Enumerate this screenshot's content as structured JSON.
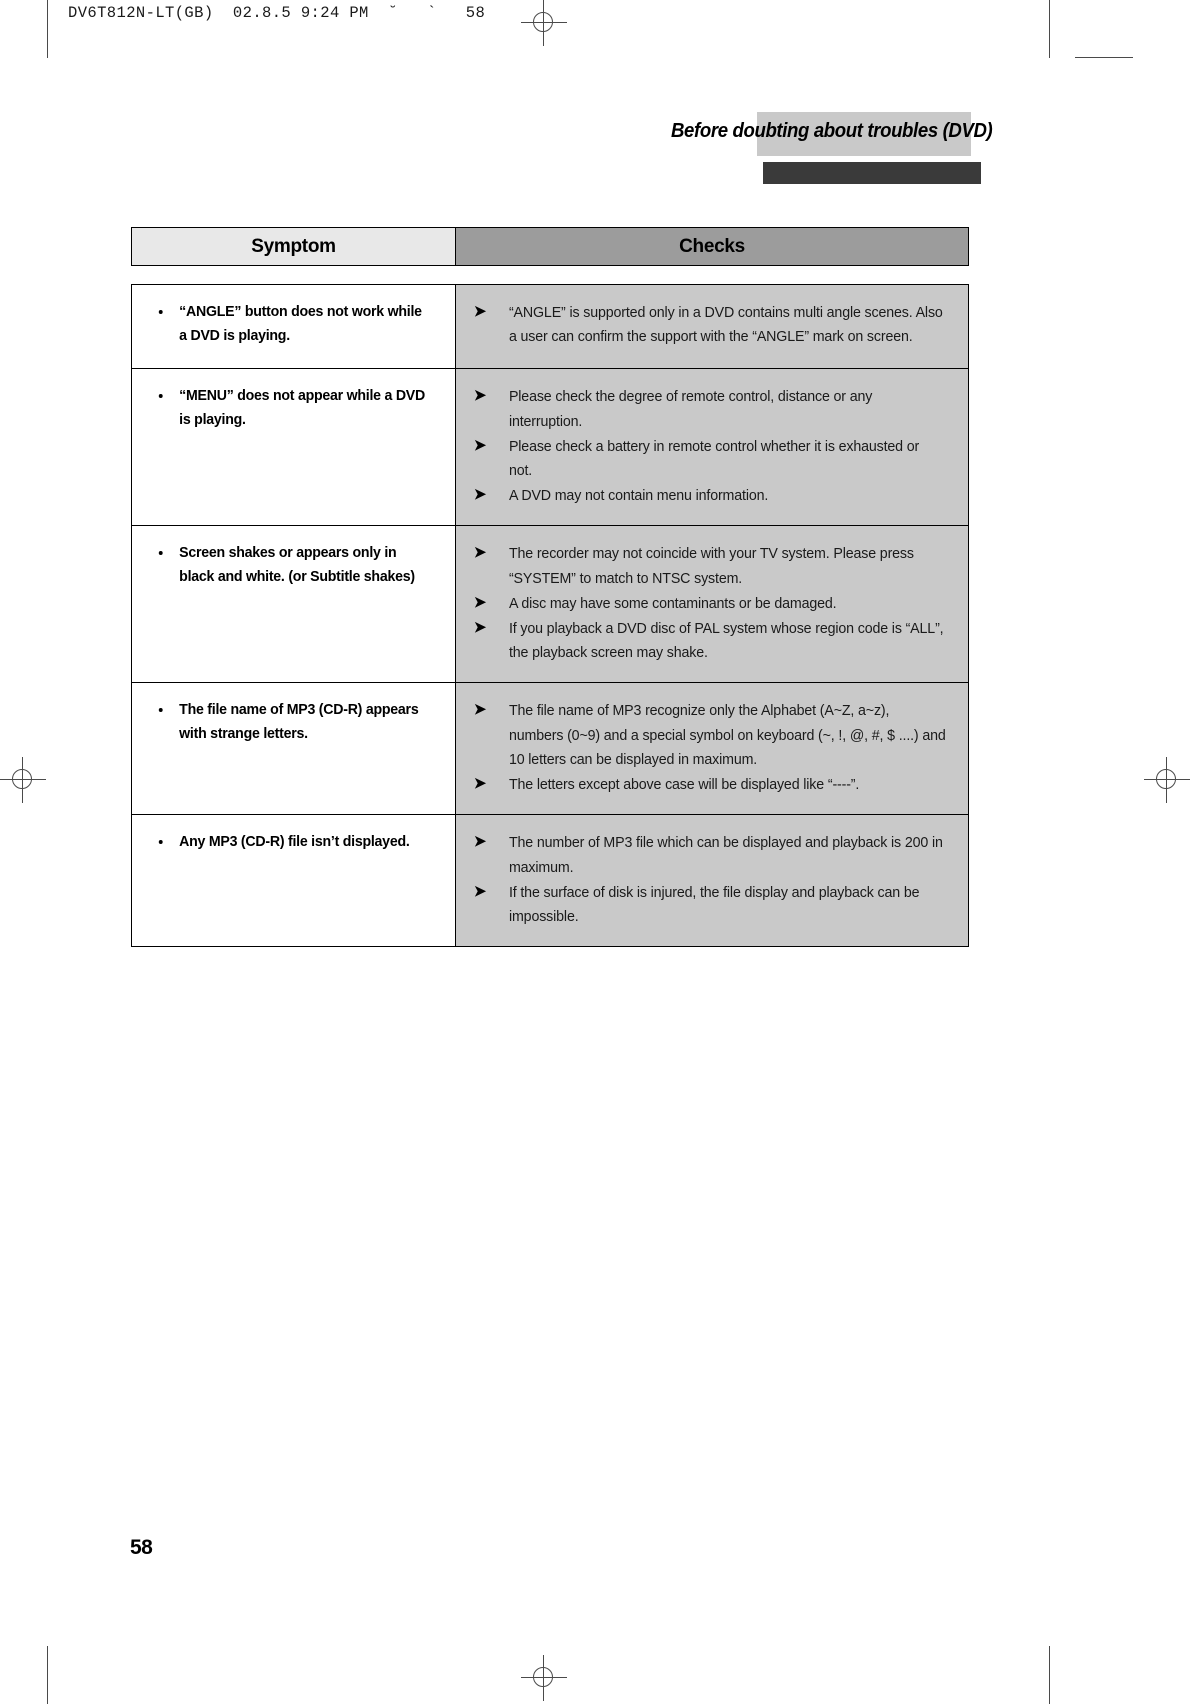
{
  "print_slug": "DV6T812N-LT(GB)  02.8.5 9:24 PM  ˘   `   58",
  "title": "Before doubting about troubles (DVD)",
  "page_number": "58",
  "table": {
    "headers": {
      "symptom": "Symptom",
      "checks": "Checks"
    },
    "rows": [
      {
        "symptom": [
          "“ANGLE” button does not work while a DVD is playing."
        ],
        "checks": [
          "“ANGLE” is supported only in a DVD contains multi angle scenes. Also a user can confirm the support with the  “ANGLE” mark on screen."
        ]
      },
      {
        "symptom": [
          "“MENU” does not appear while a DVD is playing."
        ],
        "checks": [
          "Please check the degree of remote control, distance or any interruption.",
          "Please check a battery in remote control whether it is exhausted or not.",
          "A DVD may not contain menu information."
        ]
      },
      {
        "symptom": [
          "Screen shakes or appears only in black and white. (or Subtitle shakes)"
        ],
        "checks": [
          "The recorder may not coincide with your TV system. Please press “SYSTEM” to match to NTSC system.",
          "A disc may have some contaminants or be damaged.",
          "If you playback a DVD disc of PAL system whose region code is “ALL”, the playback screen may shake."
        ]
      },
      {
        "symptom": [
          "The file name of MP3 (CD-R) appears with strange letters."
        ],
        "checks": [
          "The file name of MP3 recognize only the Alphabet (A~Z, a~z), numbers (0~9) and a special symbol on keyboard (~, !, @, #, $ ....) and 10 letters can be displayed in maximum.",
          "The letters except above case will be displayed like “----”."
        ]
      },
      {
        "symptom": [
          "Any MP3 (CD-R) file isn’t displayed."
        ],
        "checks": [
          "The number of MP3 file which can be displayed and playback is 200 in maximum.",
          "If the surface of disk is injured, the file display and playback can be impossible."
        ]
      }
    ]
  },
  "colors": {
    "header_symptom_bg": "#e8e8e8",
    "header_checks_bg": "#9c9c9c",
    "checks_cell_bg": "#c9c9c9",
    "title_band_bg": "#c9c9c9",
    "title_shadow_bg": "#3a3a3a"
  },
  "icons": {
    "bullet": "•",
    "arrow": "➤"
  }
}
